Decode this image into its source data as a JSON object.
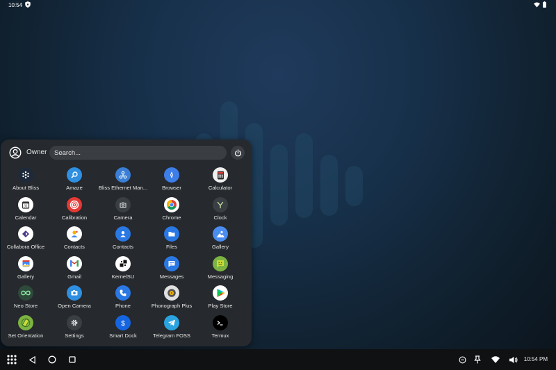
{
  "status": {
    "time": "10:54"
  },
  "drawer": {
    "user": "Owner",
    "search_placeholder": "Search...",
    "apps": [
      {
        "label": "About Bliss",
        "bg": "#1e2a3a",
        "icon": "snowflake-icon"
      },
      {
        "label": "Amaze",
        "bg": "#2f8fe0",
        "icon": "search-icon"
      },
      {
        "label": "Bliss Ethernet Man...",
        "bg": "#3a7fd5",
        "icon": "network-icon"
      },
      {
        "label": "Browser",
        "bg": "#3d7ee8",
        "icon": "compass-icon"
      },
      {
        "label": "Calculator",
        "bg": "#f0f0f0",
        "icon": "calculator-icon"
      },
      {
        "label": "Calendar",
        "bg": "#ffffff",
        "icon": "calendar-icon"
      },
      {
        "label": "Calibration",
        "bg": "#e53935",
        "icon": "target-icon"
      },
      {
        "label": "Camera",
        "bg": "#3a3f44",
        "icon": "camera-icon"
      },
      {
        "label": "Chrome",
        "bg": "#ffffff",
        "icon": "chrome-icon"
      },
      {
        "label": "Clock",
        "bg": "#3a3f44",
        "icon": "clock-icon"
      },
      {
        "label": "Collabora Office",
        "bg": "#ffffff",
        "icon": "collabora-icon"
      },
      {
        "label": "Contacts",
        "bg": "#ffffff",
        "icon": "contacts-color-icon"
      },
      {
        "label": "Contacts",
        "bg": "#2a78e4",
        "icon": "person-icon"
      },
      {
        "label": "Files",
        "bg": "#2a78e4",
        "icon": "folder-icon"
      },
      {
        "label": "Gallery",
        "bg": "#4a8df0",
        "icon": "gallery-icon"
      },
      {
        "label": "Gallery",
        "bg": "#ffffff",
        "icon": "photos-icon"
      },
      {
        "label": "Gmail",
        "bg": "#ffffff",
        "icon": "gmail-icon"
      },
      {
        "label": "KernelSU",
        "bg": "#ffffff",
        "icon": "kernelsu-icon"
      },
      {
        "label": "Messages",
        "bg": "#2a78e4",
        "icon": "message-icon"
      },
      {
        "label": "Messaging",
        "bg": "#7cb342",
        "icon": "smiley-icon"
      },
      {
        "label": "Neo Store",
        "bg": "#2e4a3a",
        "icon": "infinity-icon"
      },
      {
        "label": "Open Camera",
        "bg": "#2f8fe0",
        "icon": "open-camera-icon"
      },
      {
        "label": "Phone",
        "bg": "#2a78e4",
        "icon": "phone-icon"
      },
      {
        "label": "Phonograph Plus",
        "bg": "#e0e0e0",
        "icon": "record-icon"
      },
      {
        "label": "Play Store",
        "bg": "#ffffff",
        "icon": "play-store-icon"
      },
      {
        "label": "Set Orientation",
        "bg": "#7cb342",
        "icon": "orientation-icon"
      },
      {
        "label": "Settings",
        "bg": "#3a3f44",
        "icon": "gear-icon"
      },
      {
        "label": "Smart Dock",
        "bg": "#1565e0",
        "icon": "dollar-icon"
      },
      {
        "label": "Telegram FOSS",
        "bg": "#2aa3e0",
        "icon": "telegram-icon"
      },
      {
        "label": "Termux",
        "bg": "#000000",
        "icon": "terminal-icon"
      }
    ]
  },
  "taskbar": {
    "clock": "10:54 PM"
  }
}
